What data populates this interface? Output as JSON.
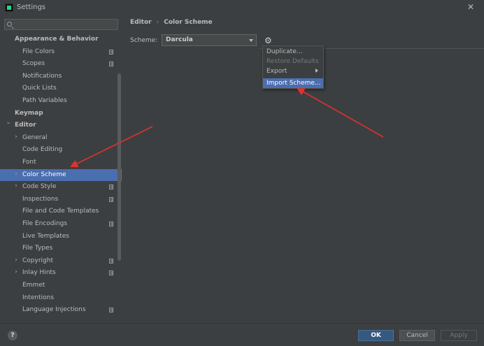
{
  "window": {
    "title": "Settings"
  },
  "search": {
    "placeholder": "",
    "value": ""
  },
  "tree": [
    {
      "label": "Appearance & Behavior",
      "level": 0,
      "bold": true,
      "chevron": ""
    },
    {
      "label": "File Colors",
      "level": 1,
      "page_icon": true
    },
    {
      "label": "Scopes",
      "level": 1,
      "page_icon": true
    },
    {
      "label": "Notifications",
      "level": 1
    },
    {
      "label": "Quick Lists",
      "level": 1
    },
    {
      "label": "Path Variables",
      "level": 1
    },
    {
      "label": "Keymap",
      "level": 0,
      "bold": true
    },
    {
      "label": "Editor",
      "level": 0,
      "bold": true,
      "chevron": "down"
    },
    {
      "label": "General",
      "level": 1,
      "chevron": "right"
    },
    {
      "label": "Code Editing",
      "level": 1
    },
    {
      "label": "Font",
      "level": 1
    },
    {
      "label": "Color Scheme",
      "level": 1,
      "chevron": "right",
      "selected": true
    },
    {
      "label": "Code Style",
      "level": 1,
      "chevron": "right",
      "page_icon": true
    },
    {
      "label": "Inspections",
      "level": 1,
      "page_icon": true
    },
    {
      "label": "File and Code Templates",
      "level": 1
    },
    {
      "label": "File Encodings",
      "level": 1,
      "page_icon": true
    },
    {
      "label": "Live Templates",
      "level": 1
    },
    {
      "label": "File Types",
      "level": 1
    },
    {
      "label": "Copyright",
      "level": 1,
      "chevron": "right",
      "page_icon": true
    },
    {
      "label": "Inlay Hints",
      "level": 1,
      "chevron": "right",
      "page_icon": true
    },
    {
      "label": "Emmet",
      "level": 1
    },
    {
      "label": "Intentions",
      "level": 1
    },
    {
      "label": "Language Injections",
      "level": 1,
      "page_icon": true
    }
  ],
  "breadcrumb": {
    "parent": "Editor",
    "current": "Color Scheme"
  },
  "scheme": {
    "label": "Scheme:",
    "value": "Darcula"
  },
  "menu": {
    "items": [
      {
        "label": "Duplicate...",
        "enabled": true
      },
      {
        "label": "Restore Defaults",
        "enabled": false
      },
      {
        "label": "Export",
        "enabled": true,
        "submenu": true
      },
      {
        "label": "Import Scheme...",
        "enabled": true,
        "highlighted": true
      }
    ]
  },
  "footer": {
    "help": "?",
    "ok": "OK",
    "cancel": "Cancel",
    "apply": "Apply"
  },
  "colors": {
    "background": "#3c3f41",
    "selection": "#4b6eaf",
    "annotation_arrow": "#e0312d",
    "ok_button": "#365880"
  },
  "icons": {
    "gear": "gear-icon",
    "search": "search-icon",
    "close": "close-icon",
    "page": "page-icon"
  }
}
